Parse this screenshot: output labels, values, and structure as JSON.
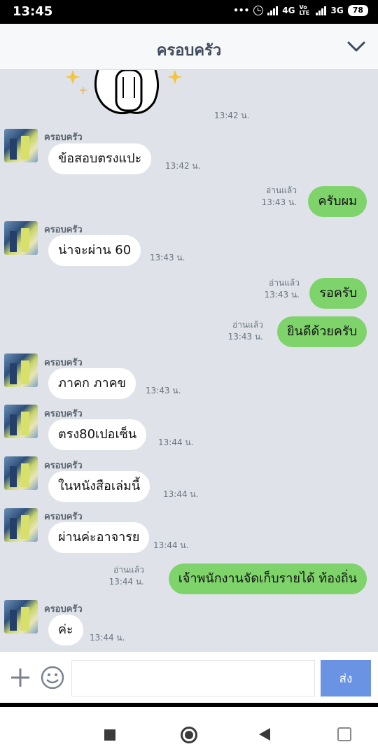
{
  "status_bar": {
    "time": "13:45",
    "dots": "•••",
    "network1": "4G",
    "volte": "Vo LTE",
    "network2": "3G",
    "battery": "78"
  },
  "header": {
    "title": "ครอบครัว"
  },
  "chat": {
    "sticker_time": "13:42 น.",
    "messages": [
      {
        "sender": "ครอบครัว",
        "text": "ข้อสอบตรงแปะ",
        "time": "13:42 น."
      },
      {
        "read": "อ่านแล้ว",
        "text": "ครับผม",
        "time": "13:43 น."
      },
      {
        "sender": "ครอบครัว",
        "text": "น่าจะผ่าน 60",
        "time": "13:43 น."
      },
      {
        "read": "อ่านแล้ว",
        "text": "รอครับ",
        "time": "13:43 น."
      },
      {
        "read": "อ่านแล้ว",
        "text": "ยินดีด้วยครับ",
        "time": "13:43 น."
      },
      {
        "sender": "ครอบครัว",
        "text": "ภาคก ภาคข",
        "time": "13:43 น."
      },
      {
        "sender": "ครอบครัว",
        "text": "ตรง80เปอเซ็น",
        "time": "13:44 น."
      },
      {
        "sender": "ครอบครัว",
        "text": "ในหนังสือเล่มนี้",
        "time": "13:44 น."
      },
      {
        "sender": "ครอบครัว",
        "text": "ผ่านค่ะอาจารย",
        "time": "13:44 น."
      },
      {
        "read": "อ่านแล้ว",
        "text": "เจ้าพนักงานจัดเก็บรายได้ ท้องถิ่น",
        "time": "13:44 น."
      },
      {
        "sender": "ครอบครัว",
        "text": "ค่ะ",
        "time": "13:44 น."
      }
    ]
  },
  "input": {
    "placeholder": "",
    "send_label": "ส่ง"
  },
  "colors": {
    "outgoing_bubble": "#7ed36b",
    "incoming_bubble": "#ffffff",
    "send_button": "#6b93e3",
    "chat_bg": "#dfe3e9"
  },
  "icons": {
    "plus": "plus-icon",
    "emoji": "emoji-icon",
    "chevron": "chevron-down-icon"
  }
}
